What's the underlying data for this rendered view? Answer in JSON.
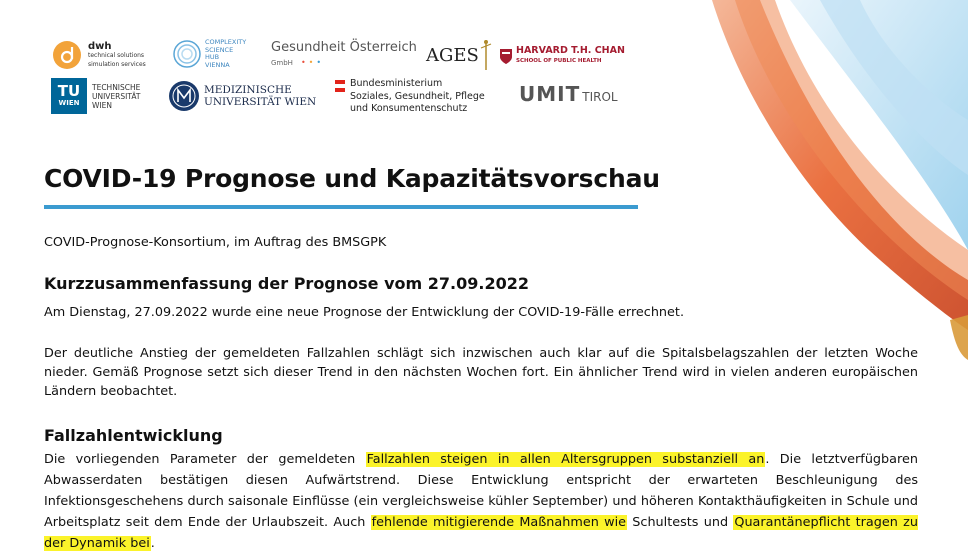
{
  "logos": {
    "dwh": {
      "name": "dwh",
      "line1": "technical solutions",
      "line2": "simulation services"
    },
    "csh": {
      "line1": "COMPLEXITY",
      "line2": "SCIENCE",
      "line3": "HUB",
      "line4": "VIENNA"
    },
    "goeg": {
      "name": "Gesundheit Österreich",
      "sub": "GmbH"
    },
    "ages": {
      "name": "AGES"
    },
    "harvard": {
      "name": "HARVARD T.H. CHAN",
      "sub": "SCHOOL OF PUBLIC HEALTH"
    },
    "tuwien": {
      "top": "TU",
      "bottom": "WIEN",
      "line1": "TECHNISCHE",
      "line2": "UNIVERSITÄT",
      "line3": "WIEN"
    },
    "meduni": {
      "line1": "MEDIZINISCHE",
      "line2": "UNIVERSITÄT WIEN"
    },
    "bmsgpk": {
      "line1": "Bundesministerium",
      "line2": "Soziales, Gesundheit, Pflege",
      "line3": "und Konsumentenschutz"
    },
    "umit": {
      "name": "UMIT",
      "sub": "TIROL"
    }
  },
  "colors": {
    "title_rule": "#3b9bd0",
    "highlight": "#fbf32a",
    "deco_orange": "#e8612c",
    "deco_blue": "#7cc0e8"
  },
  "title": "COVID-19 Prognose und Kapazitätsvorschau",
  "consortium": "COVID-Prognose-Konsortium, im Auftrag des BMSGPK",
  "summary_heading": "Kurzzusammenfassung der Prognose vom 27.09.2022",
  "summary_p1": "Am Dienstag, 27.09.2022 wurde eine neue Prognose der Entwicklung der COVID-19-Fälle errechnet.",
  "summary_p2": "Der deutliche Anstieg der gemeldeten Fallzahlen schlägt sich inzwischen auch klar auf die Spitalsbelagszahlen der letzten Woche nieder. Gemäß Prognose setzt sich dieser Trend in den nächsten Wochen fort. Ein ähnlicher Trend wird in vielen anderen europäischen Ländern beobachtet.",
  "case_heading": "Fallzahlentwicklung",
  "case_paragraph": {
    "s1": "Die vorliegenden Parameter der gemeldeten ",
    "h1": "Fallzahlen steigen in allen Altersgruppen substanziell an",
    "s2": ". Die letztverfügbaren Abwasserdaten bestätigen diesen Aufwärtstrend. Diese Entwicklung entspricht der erwarteten Beschleunigung des Infektionsgeschehens durch saisonale Einflüsse (ein vergleichsweise kühler September) und höheren Kontakthäufigkeiten in Schule und Arbeitsplatz seit dem Ende der Urlaubszeit. Auch ",
    "h2": "fehlende mitigierende Maßnahmen wie",
    "s3": " Schultests und ",
    "h3": "Quarantänepflicht tragen zu der Dynamik bei",
    "s4": "."
  }
}
